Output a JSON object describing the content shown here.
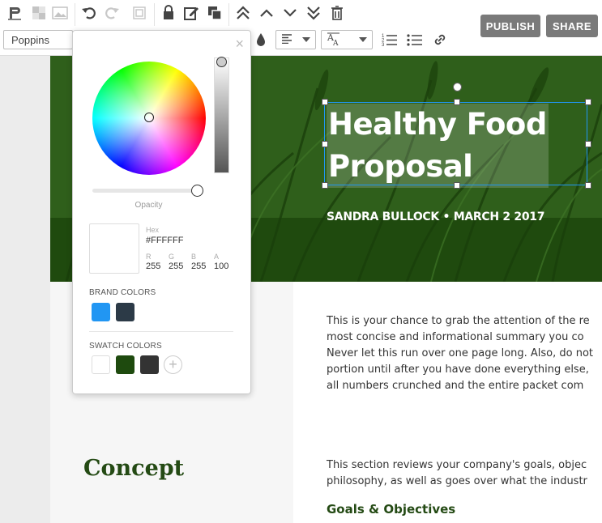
{
  "toolbar": {
    "font_family": "Poppins",
    "publish_label": "PUBLISH",
    "share_label": "SHARE"
  },
  "icons": [
    "paragraph-icon",
    "transparency-icon",
    "image-icon",
    "undo-icon",
    "redo-icon",
    "crop-icon",
    "lock-icon",
    "edit-icon",
    "copy-icon",
    "bring-front-icon",
    "move-up-icon",
    "move-down-icon",
    "send-back-icon",
    "trash-icon",
    "droplet-icon",
    "align-left-icon",
    "text-size-icon",
    "numbered-list-icon",
    "bullet-list-icon",
    "link-icon"
  ],
  "hero": {
    "title_line1": "Healthy Food",
    "title_line2": "Proposal",
    "subtitle": "SANDRA BULLOCK • MARCH 2 2017",
    "bg_color": "#2e5e1a"
  },
  "body": {
    "intro_lines": [
      "This is your chance to grab the attention of the re",
      "most concise and informational summary you co",
      "Never let this run over one page long. Also, do not",
      "portion until after you have done everything else,",
      "all numbers crunched and the entire packet com"
    ],
    "concept_heading": "Concept",
    "concept_lines": [
      "This section reviews your company's goals, objec",
      "philosophy, as well as goes over what the industr"
    ],
    "goals_heading": "Goals & Objectives"
  },
  "color_picker": {
    "opacity_label": "Opacity",
    "hex_label": "Hex",
    "hex_value": "#FFFFFF",
    "r_label": "R",
    "g_label": "G",
    "b_label": "B",
    "a_label": "A",
    "r_value": "255",
    "g_value": "255",
    "b_value": "255",
    "a_value": "100",
    "opacity_level": 1.0,
    "brand_colors_label": "BRAND COLORS",
    "brand_colors": [
      "#2196f3",
      "#2c3a47"
    ],
    "swatch_colors_label": "SWATCH COLORS",
    "swatch_colors": [
      "#ffffff",
      "#1e4a0e",
      "#333333"
    ]
  }
}
